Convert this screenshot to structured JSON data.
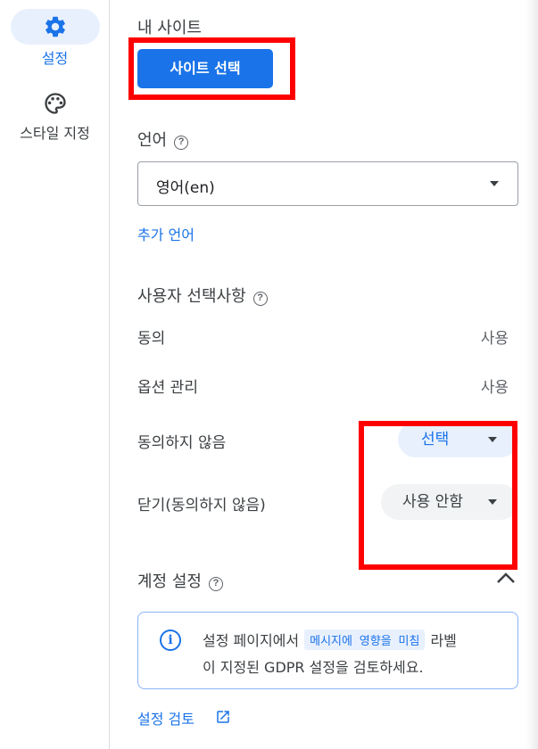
{
  "nav": {
    "items": [
      {
        "label": "설정",
        "icon": "gear-icon",
        "active": true
      },
      {
        "label": "스타일 지정",
        "icon": "palette-icon",
        "active": false
      }
    ]
  },
  "my_sites": {
    "title": "내 사이트",
    "button_label": "사이트 선택"
  },
  "language": {
    "title": "언어",
    "selected": "영어(en)",
    "add_link": "추가 언어"
  },
  "user_choices": {
    "title": "사용자 선택사항",
    "rows": [
      {
        "label": "동의",
        "value": "사용"
      },
      {
        "label": "옵션 관리",
        "value": "사용"
      },
      {
        "label": "동의하지 않음",
        "value": "선택"
      },
      {
        "label": "닫기(동의하지 않음)",
        "value": "사용 안함"
      }
    ]
  },
  "account_settings": {
    "title": "계정 설정",
    "info": {
      "text_before": "설정 페이지에서",
      "code": "메시지에 영향을 미침",
      "text_after": "라벨",
      "line2": "이 지정된 GDPR 설정을 검토하세요."
    },
    "review_link": "설정 검토"
  },
  "colors": {
    "accent": "#1a73e8",
    "highlight": "#ff0000",
    "chip_bg": "#e8f0fe"
  }
}
